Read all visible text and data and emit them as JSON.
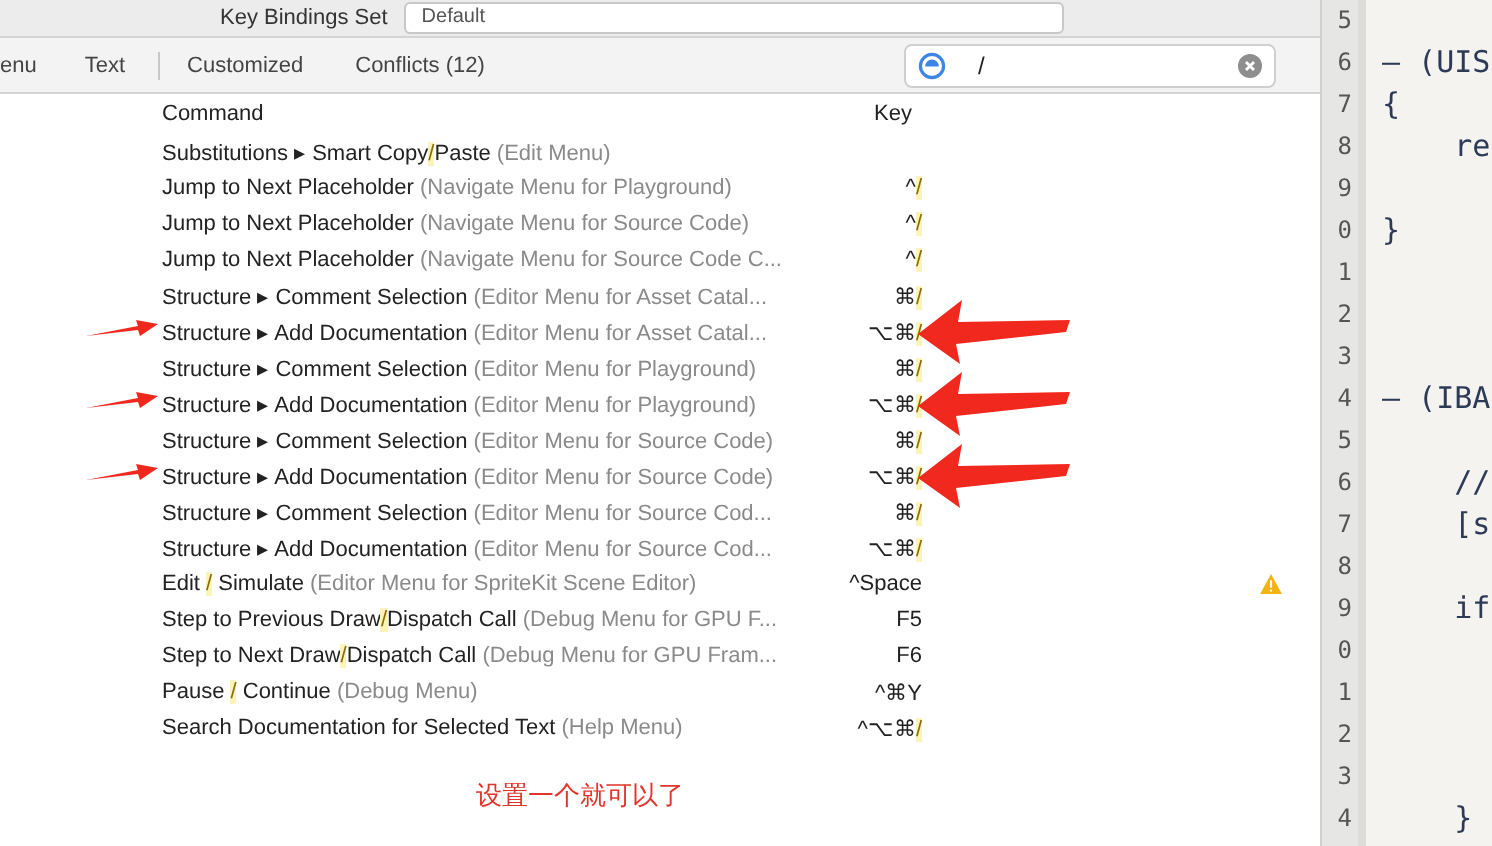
{
  "toolbar": {
    "label": "Key Bindings Set",
    "dropdown": "Default"
  },
  "tabs": [
    {
      "label": "enu",
      "selected": false
    },
    {
      "label": "Text",
      "selected": false
    },
    {
      "label": "Customized",
      "selected": false
    },
    {
      "label": "Conflicts (12)",
      "selected": false
    }
  ],
  "search": {
    "value": "/"
  },
  "table": {
    "columns": [
      "Command",
      "Key"
    ],
    "rows": [
      {
        "command": [
          {
            "text": "Substitutions ▸ Smart Copy"
          },
          {
            "text": "/",
            "match": true
          },
          {
            "text": "Paste"
          }
        ],
        "context": "(Edit Menu)",
        "key": [],
        "arrow": false,
        "warning": false
      },
      {
        "command": [
          {
            "text": "Jump to Next Placeholder"
          }
        ],
        "context": "(Navigate Menu for Playground)",
        "key": [
          {
            "text": "^"
          },
          {
            "text": "/",
            "match": true
          }
        ],
        "arrow": false,
        "warning": false
      },
      {
        "command": [
          {
            "text": "Jump to Next Placeholder"
          }
        ],
        "context": "(Navigate Menu for Source Code)",
        "key": [
          {
            "text": "^"
          },
          {
            "text": "/",
            "match": true
          }
        ],
        "arrow": false,
        "warning": false
      },
      {
        "command": [
          {
            "text": "Jump to Next Placeholder"
          }
        ],
        "context": "(Navigate Menu for Source Code C...",
        "key": [
          {
            "text": "^"
          },
          {
            "text": "/",
            "match": true
          }
        ],
        "arrow": false,
        "warning": false
      },
      {
        "command": [
          {
            "text": "Structure ▸ Comment Selection"
          }
        ],
        "context": "(Editor Menu for Asset Catal...",
        "key": [
          {
            "text": "⌘"
          },
          {
            "text": "/",
            "match": true
          }
        ],
        "arrow": false,
        "warning": false
      },
      {
        "command": [
          {
            "text": "Structure ▸ Add Documentation"
          }
        ],
        "context": "(Editor Menu for Asset Catal...",
        "key": [
          {
            "text": "⌥⌘"
          },
          {
            "text": "/",
            "match": true
          }
        ],
        "arrow": true,
        "warning": false
      },
      {
        "command": [
          {
            "text": "Structure ▸ Comment Selection"
          }
        ],
        "context": "(Editor Menu for Playground)",
        "key": [
          {
            "text": "⌘"
          },
          {
            "text": "/",
            "match": true
          }
        ],
        "arrow": false,
        "warning": false
      },
      {
        "command": [
          {
            "text": "Structure ▸ Add Documentation"
          }
        ],
        "context": "(Editor Menu for Playground)",
        "key": [
          {
            "text": "⌥⌘"
          },
          {
            "text": "/",
            "match": true
          }
        ],
        "arrow": true,
        "warning": false
      },
      {
        "command": [
          {
            "text": "Structure ▸ Comment Selection"
          }
        ],
        "context": "(Editor Menu for Source Code)",
        "key": [
          {
            "text": "⌘"
          },
          {
            "text": "/",
            "match": true
          }
        ],
        "arrow": false,
        "warning": false
      },
      {
        "command": [
          {
            "text": "Structure ▸ Add Documentation"
          }
        ],
        "context": "(Editor Menu for Source Code)",
        "key": [
          {
            "text": "⌥⌘"
          },
          {
            "text": "/",
            "match": true
          }
        ],
        "arrow": true,
        "warning": false
      },
      {
        "command": [
          {
            "text": "Structure ▸ Comment Selection"
          }
        ],
        "context": "(Editor Menu for Source Cod...",
        "key": [
          {
            "text": "⌘"
          },
          {
            "text": "/",
            "match": true
          }
        ],
        "arrow": false,
        "warning": false
      },
      {
        "command": [
          {
            "text": "Structure ▸ Add Documentation"
          }
        ],
        "context": "(Editor Menu for Source Cod...",
        "key": [
          {
            "text": "⌥⌘"
          },
          {
            "text": "/",
            "match": true
          }
        ],
        "arrow": false,
        "warning": false
      },
      {
        "command": [
          {
            "text": "Edit "
          },
          {
            "text": "/",
            "match": true
          },
          {
            "text": " Simulate"
          }
        ],
        "context": "(Editor Menu for SpriteKit Scene Editor)",
        "key": [
          {
            "text": "^Space"
          }
        ],
        "arrow": false,
        "warning": true
      },
      {
        "command": [
          {
            "text": "Step to Previous Draw"
          },
          {
            "text": "/",
            "match": true
          },
          {
            "text": "Dispatch Call"
          }
        ],
        "context": "(Debug Menu for GPU F...",
        "key": [
          {
            "text": "F5"
          }
        ],
        "arrow": false,
        "warning": false
      },
      {
        "command": [
          {
            "text": "Step to Next Draw"
          },
          {
            "text": "/",
            "match": true
          },
          {
            "text": "Dispatch Call"
          }
        ],
        "context": "(Debug Menu for GPU Fram...",
        "key": [
          {
            "text": "F6"
          }
        ],
        "arrow": false,
        "warning": false
      },
      {
        "command": [
          {
            "text": "Pause "
          },
          {
            "text": "/",
            "match": true
          },
          {
            "text": " Continue"
          }
        ],
        "context": "(Debug Menu)",
        "key": [
          {
            "text": "^⌘Y"
          }
        ],
        "arrow": false,
        "warning": false
      },
      {
        "command": [
          {
            "text": "Search Documentation for Selected Text"
          }
        ],
        "context": "(Help Menu)",
        "key": [
          {
            "text": "^⌥⌘"
          },
          {
            "text": "/",
            "match": true
          }
        ],
        "arrow": false,
        "warning": false
      }
    ]
  },
  "note": "设置一个就可以了",
  "editor": {
    "lines": [
      {
        "number": "5"
      },
      {
        "number": "6",
        "code": "– (UIS"
      },
      {
        "number": "7",
        "code": "{"
      },
      {
        "number": "8",
        "code": "    re"
      },
      {
        "number": "9"
      },
      {
        "number": "0",
        "code": "}"
      },
      {
        "number": "1"
      },
      {
        "number": "2"
      },
      {
        "number": "3"
      },
      {
        "number": "4",
        "code": "– (IBA"
      },
      {
        "number": "5"
      },
      {
        "number": "6",
        "code": "    //"
      },
      {
        "number": "7",
        "code": "    [s"
      },
      {
        "number": "8"
      },
      {
        "number": "9",
        "code": "    if"
      },
      {
        "number": "0"
      },
      {
        "number": "1"
      },
      {
        "number": "2"
      },
      {
        "number": "3"
      },
      {
        "number": "4",
        "code": "    }"
      }
    ]
  }
}
